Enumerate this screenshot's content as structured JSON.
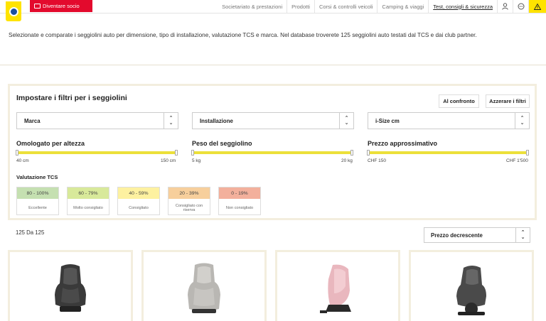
{
  "header": {
    "member_button": "Diventare socio",
    "nav": [
      {
        "label": "Societariato & prestazioni",
        "active": false
      },
      {
        "label": "Prodotti",
        "active": false
      },
      {
        "label": "Corsi & controlli veicoli",
        "active": false
      },
      {
        "label": "Camping & viaggi",
        "active": false
      },
      {
        "label": "Test, consigli & sicurezza",
        "active": true
      }
    ],
    "icons": [
      "user-icon",
      "chat-icon",
      "warning-icon"
    ]
  },
  "intro": "Selezionate e comparate i seggiolini auto per dimensione, tipo di installazione, valutazione TCS e marca. Nel database troverete 125 seggiolini auto testati dal TCS e dai club partner.",
  "filters": {
    "title": "Impostare i filtri per i seggiolini",
    "compare_button": "Al confronto",
    "reset_button": "Azzerare i filtri",
    "selects": [
      {
        "value": "Marca"
      },
      {
        "value": "Installazione"
      },
      {
        "value": "i-Size cm"
      }
    ],
    "sliders": [
      {
        "title": "Omologato per altezza",
        "min": "40 cm",
        "max": "150 cm"
      },
      {
        "title": "Peso del seggiolino",
        "min": "5 kg",
        "max": "20 kg"
      },
      {
        "title": "Prezzo approssimativo",
        "min": "CHF 150",
        "max": "CHF 1'500"
      }
    ],
    "rating_title": "Valutazione TCS",
    "ratings": [
      {
        "range": "80 - 100%",
        "label": "Eccellente",
        "color": "#c5e0b1"
      },
      {
        "range": "60 - 79%",
        "label": "Molto consigliato",
        "color": "#d8e99a"
      },
      {
        "range": "40 - 59%",
        "label": "Consigliato",
        "color": "#fdf1a0"
      },
      {
        "range": "20 - 39%",
        "label": "Consigliato con riserva",
        "color": "#f7cf9c"
      },
      {
        "range": "0 - 19%",
        "label": "Non consigliato",
        "color": "#f3b09c"
      }
    ]
  },
  "results": {
    "count": "125 Da 125",
    "sort": "Prezzo decrescente"
  },
  "colors": {
    "brand_yellow": "#ffe300",
    "brand_red": "#e30a2d",
    "panel_border": "#f3eede",
    "slider": "#ece03a"
  }
}
